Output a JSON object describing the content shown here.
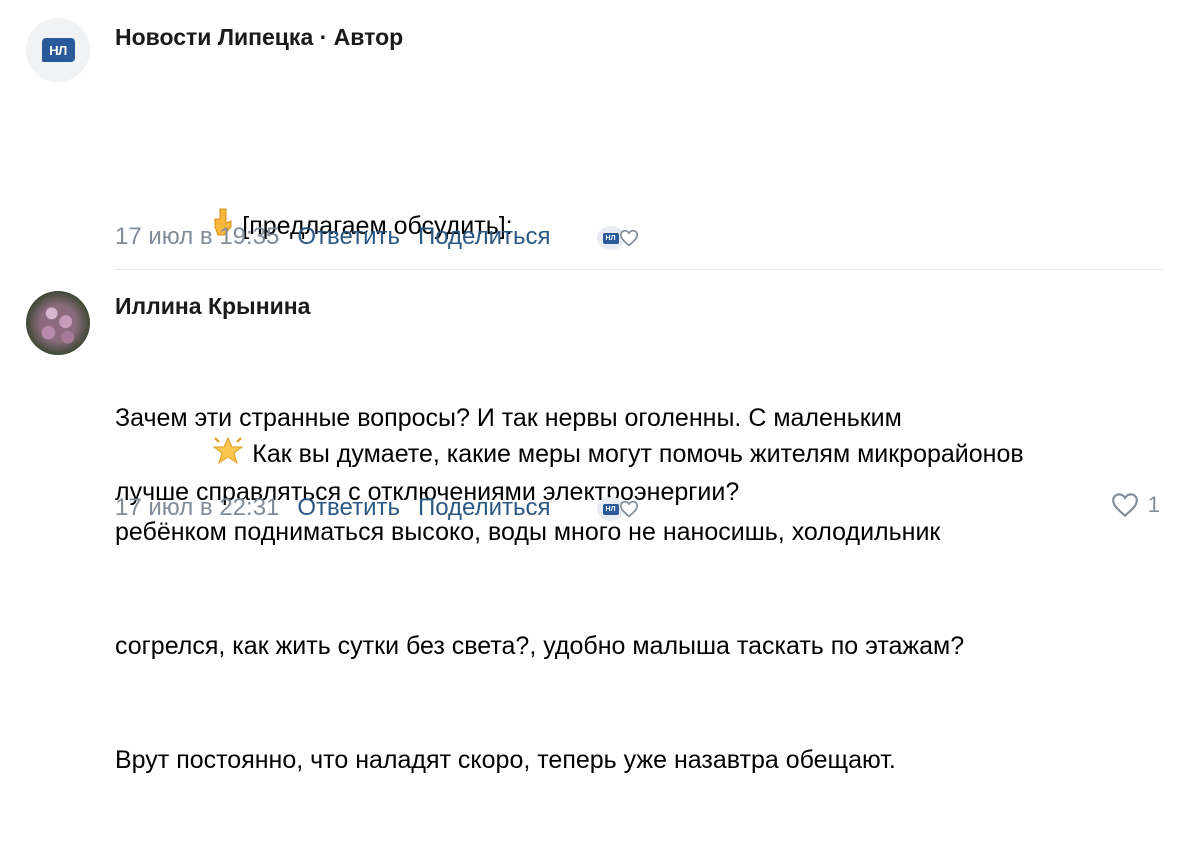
{
  "comments": [
    {
      "author": "Новости Липецка · Автор",
      "avatar_label": "НЛ",
      "lines": [
        {
          "emoji_icon": "pointing-down-icon",
          "text": "[предлагаем обсудить]:"
        },
        {
          "text": ""
        },
        {
          "emoji_icon": "glowing-star-icon",
          "text": "Как вы думаете, какие меры могут помочь жителям микрорайонов"
        },
        {
          "text": "лучше справляться с отключениями электроэнергии?"
        }
      ],
      "date": "17 июл в 19:35",
      "reply_label": "Ответить",
      "share_label": "Поделиться",
      "liker_label": "НЛ"
    },
    {
      "author": "Иллина Крынина",
      "lines": [
        {
          "text": "Зачем эти странные вопросы? И так нервы оголенны. С маленьким"
        },
        {
          "text": "ребёнком подниматься высоко, воды много не наносишь, холодильник"
        },
        {
          "text": "согрелся, как жить сутки без света?, удобно малыша таскать по этажам?"
        },
        {
          "text": "Врут постоянно, что наладят скоро, теперь уже назавтра обещают."
        }
      ],
      "date": "17 июл в 22:31",
      "reply_label": "Ответить",
      "share_label": "Поделиться",
      "liker_label": "НЛ",
      "like_count": "1"
    }
  ],
  "colors": {
    "link": "#2a5885",
    "meta": "#818c99",
    "logo": "#2a5a9a"
  }
}
